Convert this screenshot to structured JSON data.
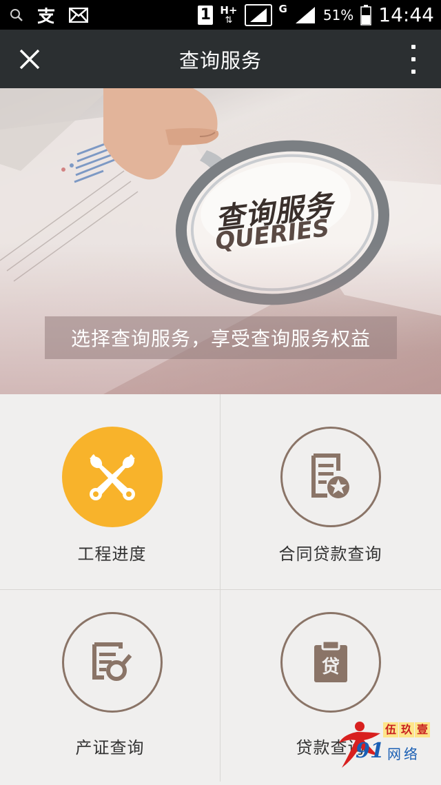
{
  "status_bar": {
    "left_icons": [
      "search-icon",
      "alipay-icon",
      "mail-icon"
    ],
    "sim_label": "1",
    "network_1": "H+",
    "network_2": "G",
    "battery_percent": "51%",
    "time": "14:44"
  },
  "title_bar": {
    "title": "查询服务",
    "close_icon": "close-icon",
    "more_icon": "more-vertical-icon"
  },
  "banner": {
    "lens_title": "查询服务",
    "lens_subtitle": "QUERIES",
    "caption": "选择查询服务，享受查询服务权益"
  },
  "services": [
    {
      "label": "工程进度",
      "icon": "wrench-cross-icon",
      "style": "filled",
      "color": "#f8b32b"
    },
    {
      "label": "合同贷款查询",
      "icon": "contract-star-icon",
      "style": "outline",
      "color": "#8a7467"
    },
    {
      "label": "产证查询",
      "icon": "certificate-search-icon",
      "style": "outline",
      "color": "#8a7467"
    },
    {
      "label": "贷款查询",
      "icon": "loan-clipboard-icon",
      "style": "outline",
      "color": "#8a7467"
    }
  ],
  "watermark": {
    "number": "91",
    "top_chars": [
      "伍",
      "玖",
      "壹"
    ],
    "bottom_text": "网络"
  },
  "colors": {
    "title_bar_bg": "#2b2f31",
    "accent_yellow": "#f8b32b",
    "icon_brown": "#8a7467"
  }
}
